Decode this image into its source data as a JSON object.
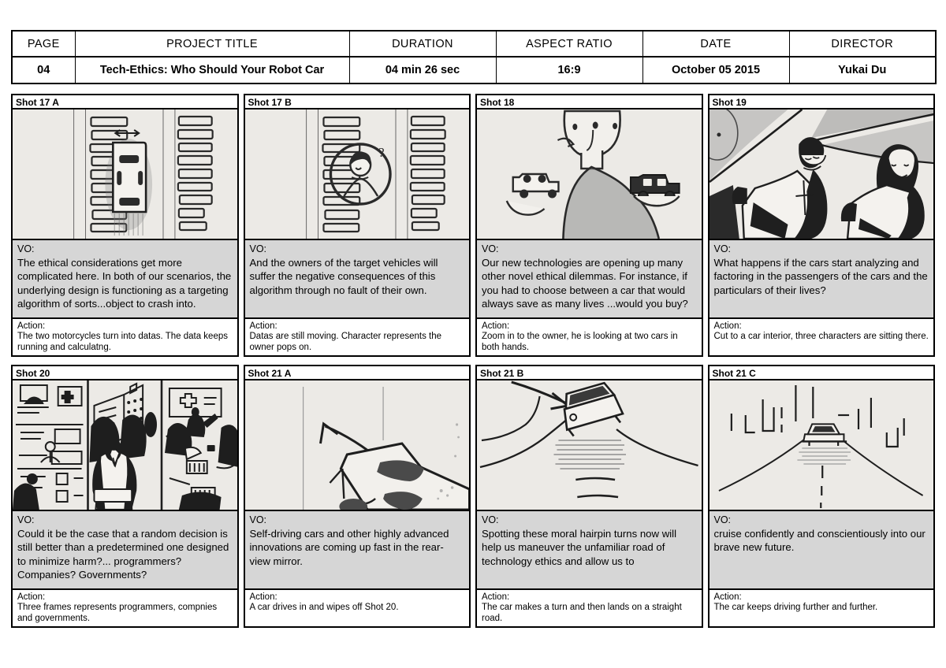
{
  "header": {
    "columns": [
      {
        "label": "PAGE",
        "value": "04"
      },
      {
        "label": "PROJECT TITLE",
        "value": "Tech-Ethics: Who Should Your Robot Car"
      },
      {
        "label": "DURATION",
        "value": "04 min 26 sec"
      },
      {
        "label": "ASPECT RATIO",
        "value": "16:9"
      },
      {
        "label": "DATE",
        "value": "October 05 2015"
      },
      {
        "label": "DIRECTOR",
        "value": "Yukai Du"
      }
    ]
  },
  "labels": {
    "vo": "VO:",
    "action": "Action:"
  },
  "colors": {
    "vo_background": "#d6d6d6",
    "action_background": "#ffffff",
    "frame_paper": "#eceae6",
    "ink": "#000000"
  },
  "panels": [
    {
      "shot": "Shot 17 A",
      "sketch": "top-down-road-with-car-and-data-blocks",
      "vo": "The ethical considerations get more complicated here. In both of our scenarios, the underlying design is functioning as a targeting algorithm of sorts...object to crash into.",
      "action": "The two motorcycles turn into datas. The data keeps running and calculatng."
    },
    {
      "shot": "Shot 17 B",
      "sketch": "road-with-data-blocks-and-owner-portrait-circle",
      "vo": "And the owners of the target vehicles will suffer the negative consequences of this algorithm through no fault of their own.",
      "action": "Datas are still moving. Character represents the owner pops on."
    },
    {
      "shot": "Shot 18",
      "sketch": "person-holding-two-cars-in-both-hands",
      "vo": "Our new technologies are opening up many other novel ethical dilemmas. For instance, if you had to choose between a car that would always save as many lives ...would you buy?",
      "action": "Zoom in to the owner, he is looking at two cars in both hands."
    },
    {
      "shot": "Shot 19",
      "sketch": "car-interior-with-three-passengers",
      "vo": "What happens if the cars start analyzing and factoring in the passengers of the cars and the particulars of their lives?",
      "action": "Cut to a car interior, three characters are sitting there."
    },
    {
      "shot": "Shot 20",
      "sketch": "three-frames-programmers-companies-governments",
      "vo": "Could it be the case that a random decision is still better than a predetermined one designed to minimize harm?... programmers? Companies? Governments?",
      "action": "Three frames represents programmers, compnies and governments."
    },
    {
      "shot": "Shot 21 A",
      "sketch": "car-driving-in-with-motion-arrow",
      "vo": "Self-driving cars and other highly advanced innovations are coming up fast in the rear-view mirror.",
      "action": "A car drives in and wipes off Shot 20."
    },
    {
      "shot": "Shot 21 B",
      "sketch": "car-turning-onto-hilltop-road",
      "vo": "Spotting these moral hairpin turns now will help us maneuver the unfamiliar road of technology ethics and allow us to",
      "action": "The car makes a turn and then lands on a straight road."
    },
    {
      "shot": "Shot 21 C",
      "sketch": "car-driving-into-distant-city-skyline",
      "vo": "cruise confidently and conscientiously into our brave new future.",
      "action": "The car keeps driving further and further."
    }
  ]
}
